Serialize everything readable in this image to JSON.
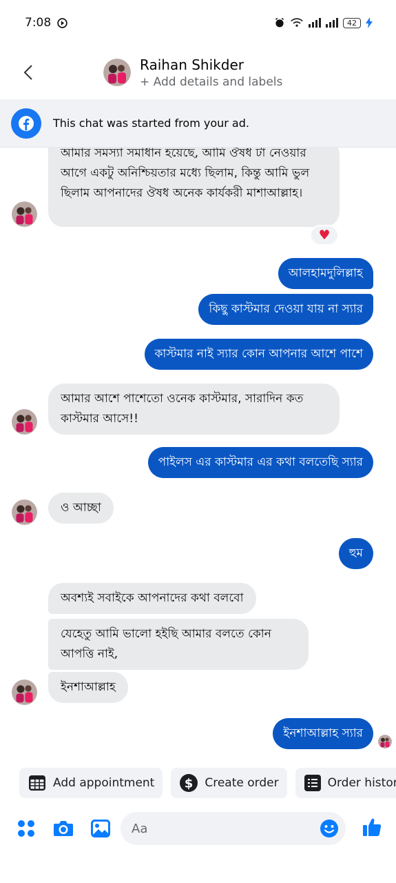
{
  "status": {
    "time": "7:08",
    "battery": "42"
  },
  "header": {
    "contact_name": "Raihan Shikder",
    "subtitle": "+ Add details and labels"
  },
  "banner": {
    "text": "This chat was started from your ad."
  },
  "messages": {
    "m1": "আমার সমস্যা সমাধান হয়েছে, আমি ঔষধ টা নেওয়ার আগে একটু অনিশ্চিয়তার মধ্যে ছিলাম, কিন্তু আমি ভুল ছিলাম আপনাদের ঔষধ অনেক কার্যকরী মাশাআল্লাহ।",
    "m1_reaction": "♥",
    "m2": "আলহামদুলিল্লাহ",
    "m3": "কিছু কাস্টমার দেওয়া যায় না স্যার",
    "m4": "কাস্টমার নাই স্যার কোন আপনার আশে পাশে",
    "m5": "আমার আশে পাশেতো ওনেক কাস্টমার, সারাদিন কত কাস্টমার আসে!!",
    "m6": "পাইলস এর কাস্টমার এর কথা বলতেছি স্যার",
    "m7": "ও আচ্ছা",
    "m8": "হুম",
    "m9": "অবশ্যই সবাইকে আপনাদের কথা বলবো",
    "m10": "যেহেতু আমি ভালো হইছি আমার বলতে কোন আপত্তি নাই,",
    "m11": "ইনশাআল্লাহ",
    "m12": "ইনশাআল্লাহ স্যার"
  },
  "quick_actions": {
    "add_appointment": "Add appointment",
    "create_order": "Create order",
    "order_history": "Order history"
  },
  "composer": {
    "placeholder": "Aa"
  },
  "colors": {
    "accent": "#0a57c4",
    "incoming_bubble": "#e9eaec",
    "facebook_blue": "#1877f2",
    "reaction_heart": "#e41e3f"
  }
}
